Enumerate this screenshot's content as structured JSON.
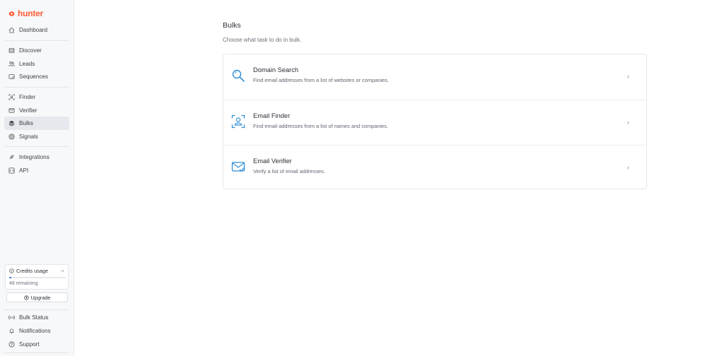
{
  "brand": {
    "name": "hunter",
    "color": "#ff5c35"
  },
  "sidebar": {
    "items": [
      {
        "label": "Dashboard",
        "icon": "home-icon"
      },
      {
        "label": "Discover",
        "icon": "discover-icon"
      },
      {
        "label": "Leads",
        "icon": "users-icon"
      },
      {
        "label": "Sequences",
        "icon": "sequences-icon"
      },
      {
        "label": "Finder",
        "icon": "finder-icon"
      },
      {
        "label": "Verifier",
        "icon": "shield-icon"
      },
      {
        "label": "Bulks",
        "icon": "layers-icon",
        "active": true
      },
      {
        "label": "Signals",
        "icon": "signals-icon"
      },
      {
        "label": "Integrations",
        "icon": "plug-icon"
      },
      {
        "label": "API",
        "icon": "api-icon"
      }
    ],
    "bottom_items": [
      {
        "label": "Bulk Status",
        "icon": "broadcast-icon"
      },
      {
        "label": "Notifications",
        "icon": "bell-icon"
      },
      {
        "label": "Support",
        "icon": "help-icon"
      }
    ],
    "credits": {
      "title": "Credits usage",
      "remaining": "48 remaining",
      "progress": 0.04
    },
    "upgrade_label": "Upgrade"
  },
  "main": {
    "title": "Bulks",
    "subtitle": "Choose what task to do in bulk.",
    "cards": [
      {
        "title": "Domain Search",
        "description": "Find email addresses from a list of websites or companies.",
        "icon": "magnifier-icon"
      },
      {
        "title": "Email Finder",
        "description": "Find email addresses from a list of names and companies.",
        "icon": "person-scan-icon"
      },
      {
        "title": "Email Verifier",
        "description": "Verify a list of email addresses.",
        "icon": "mail-check-icon"
      }
    ]
  },
  "colors": {
    "accent_blue": "#2f8fd8",
    "active_bg": "#e6e8ed"
  }
}
